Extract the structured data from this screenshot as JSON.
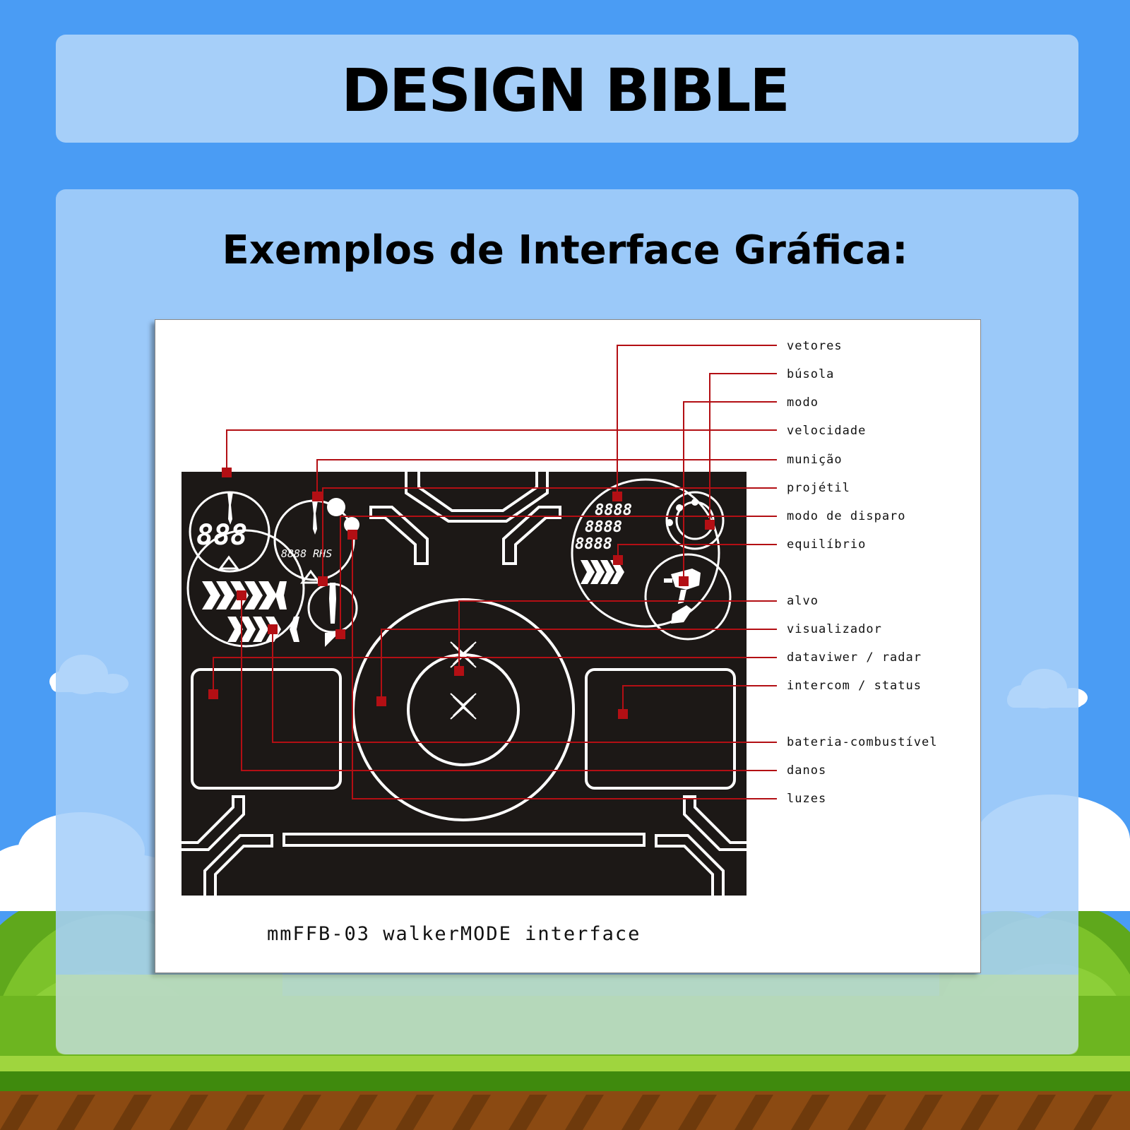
{
  "header": {
    "title": "DESIGN BIBLE"
  },
  "section": {
    "subtitle": "Exemplos de Interface Gráfica:"
  },
  "diagram": {
    "caption": "mmFFB-03 walkerMODE interface",
    "readouts": {
      "digits_left": "888",
      "digits_mid": "8888 RHS",
      "digits_right_1": "8888",
      "digits_right_2": "8888",
      "digits_right_3": "8888"
    },
    "labels": [
      "vetores",
      "búsola",
      "modo",
      "velocidade",
      "munição",
      "projétil",
      "modo de disparo",
      "equilíbrio",
      "alvo",
      "visualizador",
      "dataviwer / radar",
      "intercom / status",
      "bateria-combustível",
      "danos",
      "luzes"
    ]
  },
  "colors": {
    "background": "#4a9cf4",
    "panel": "#a6cff9",
    "hud": "#1c1816",
    "callout": "#b30f14",
    "grass": "#7cc22a",
    "soil": "#8b4a12"
  }
}
